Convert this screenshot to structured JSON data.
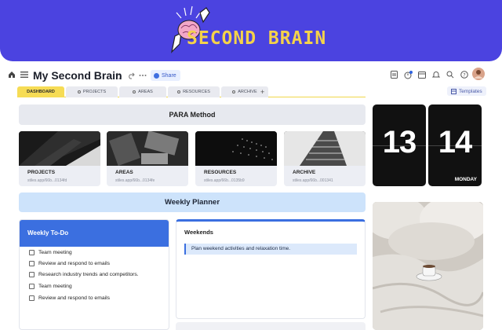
{
  "banner": {
    "title": "SECOND BRAIN"
  },
  "topbar": {
    "page_title": "My Second Brain",
    "share_label": "Share",
    "templates_label": "Templates",
    "icons": [
      "home-icon",
      "menu-icon",
      "undo-icon",
      "redo-icon",
      "more-icon",
      "doc-icon",
      "clock-icon",
      "calendar-icon",
      "bell-icon",
      "search-icon",
      "help-icon",
      "avatar"
    ]
  },
  "tabs": [
    {
      "label": "DASHBOARD",
      "active": true
    },
    {
      "label": "PROJECTS"
    },
    {
      "label": "AREAS"
    },
    {
      "label": "RESOURCES"
    },
    {
      "label": "ARCHIVE"
    }
  ],
  "tab_add": "+",
  "para": {
    "title": "PARA Method",
    "cards": [
      {
        "label": "PROJECTS",
        "url": "stiles.app/66b...0134fd"
      },
      {
        "label": "AREAS",
        "url": "stiles.app/66b...0134fe"
      },
      {
        "label": "RESOURCES",
        "url": "stiles.app/66b...0135b9"
      },
      {
        "label": "ARCHIVE",
        "url": "stiles.app/66b...001341"
      }
    ]
  },
  "clock": {
    "hour": "13",
    "minute": "14",
    "day": "MONDAY"
  },
  "weekly": {
    "title": "Weekly Planner",
    "todo_title": "Weekly To-Do",
    "todos": [
      "Team meeting",
      "Review and respond to emails",
      "Research industry trends and competitors.",
      "Team meeting",
      "Review and respond to emails"
    ],
    "weekends_title": "Weekends",
    "weekends_note": "Plan weekend activities and relaxation time."
  },
  "colors": {
    "banner": "#4b43e0",
    "banner_text": "#f4d24a",
    "accent": "#3b6fe0",
    "tab_active": "#f6dc55"
  }
}
